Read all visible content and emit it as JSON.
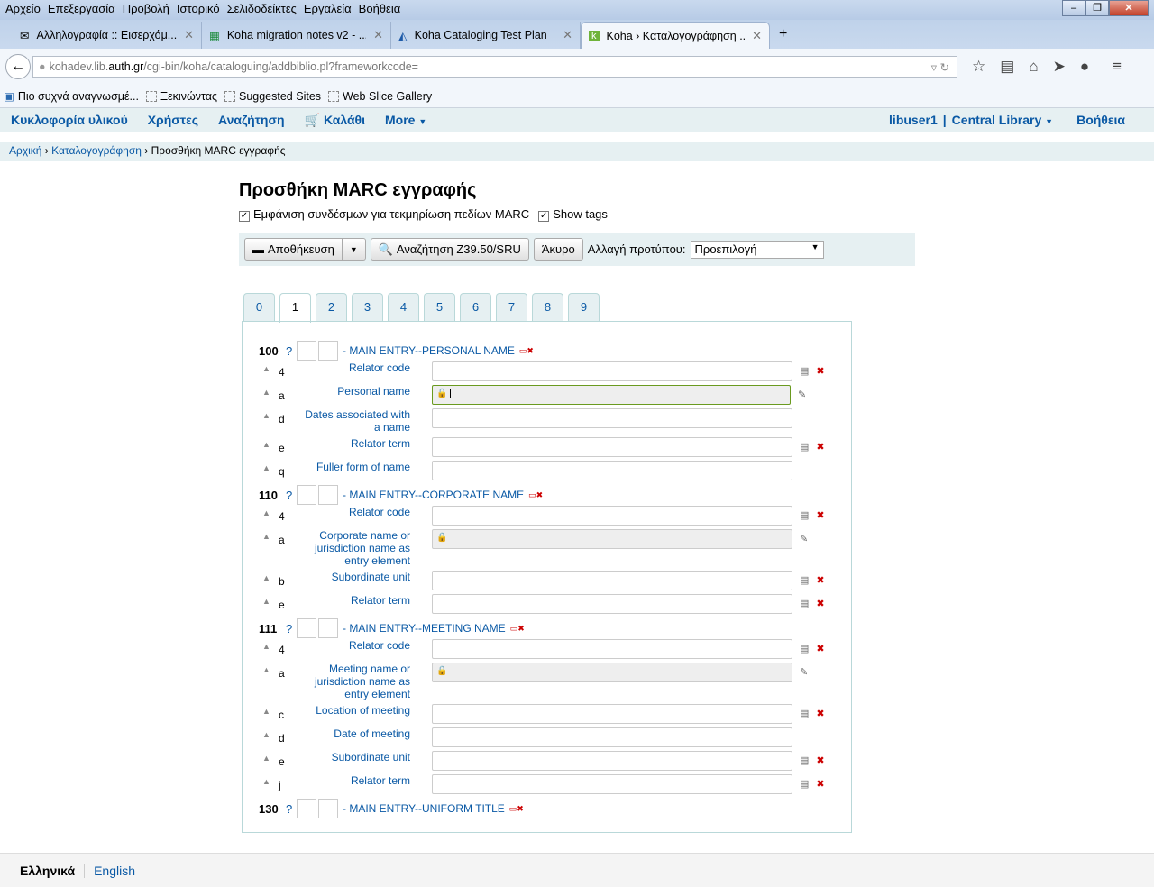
{
  "browser": {
    "menu": [
      "Αρχείο",
      "Επεξεργασία",
      "Προβολή",
      "Ιστορικό",
      "Σελιδοδείκτες",
      "Εργαλεία",
      "Βοήθεια"
    ],
    "tabs": [
      {
        "title": "Αλληλογραφία :: Εισερχόμ...",
        "icon": "mail-icon"
      },
      {
        "title": "Koha migration notes v2 - ...",
        "icon": "sheet-icon"
      },
      {
        "title": "Koha Cataloging Test Plan",
        "icon": "doc-icon"
      },
      {
        "title": "Koha › Καταλογογράφηση ...",
        "icon": "koha-icon",
        "active": true
      }
    ],
    "url_pre": "kohadev.lib.",
    "url_host": "auth.gr",
    "url_post": "/cgi-bin/koha/cataloguing/addbiblio.pl?frameworkcode=",
    "bookmarks": [
      "Πιο συχνά αναγνωσμέ...",
      "Ξεκινώντας",
      "Suggested Sites",
      "Web Slice Gallery"
    ]
  },
  "nav": {
    "items": [
      "Κυκλοφορία υλικού",
      "Χρήστες",
      "Αναζήτηση",
      "Καλάθι",
      "More"
    ],
    "user": "libuser1",
    "library": "Central Library",
    "help": "Βοήθεια"
  },
  "breadcrumbs": [
    "Αρχική",
    "Καταλογογράφηση",
    "Προσθήκη MARC εγγραφής"
  ],
  "page": {
    "title": "Προσθήκη MARC εγγραφής",
    "opt1": "Εμφάνιση συνδέσμων για τεκμηρίωση πεδίων MARC",
    "opt2": "Show tags",
    "save": "Αποθήκευση",
    "z3950": "Αναζήτηση Z39.50/SRU",
    "cancel": "Άκυρο",
    "template_label": "Αλλαγή προτύπου:",
    "template": "Προεπιλογή"
  },
  "tabs": [
    "0",
    "1",
    "2",
    "3",
    "4",
    "5",
    "6",
    "7",
    "8",
    "9"
  ],
  "active_tab": "1",
  "fields": [
    {
      "tag": "100",
      "name": "- MAIN ENTRY--PERSONAL NAME",
      "subfields": [
        {
          "code": "4",
          "label": "Relator code",
          "icons": "list-delete"
        },
        {
          "code": "a",
          "label": "Personal name",
          "icons": "plugin",
          "locked": true,
          "focused": true
        },
        {
          "code": "d",
          "label": "Dates associated with a name",
          "icons": "none"
        },
        {
          "code": "e",
          "label": "Relator term",
          "icons": "list-delete"
        },
        {
          "code": "q",
          "label": "Fuller form of name",
          "icons": "none"
        }
      ]
    },
    {
      "tag": "110",
      "name": "- MAIN ENTRY--CORPORATE NAME",
      "subfields": [
        {
          "code": "4",
          "label": "Relator code",
          "icons": "list-delete"
        },
        {
          "code": "a",
          "label": "Corporate name or jurisdiction name as entry element",
          "icons": "plugin",
          "locked": true
        },
        {
          "code": "b",
          "label": "Subordinate unit",
          "icons": "list-delete"
        },
        {
          "code": "e",
          "label": "Relator term",
          "icons": "list-delete"
        }
      ]
    },
    {
      "tag": "111",
      "name": "- MAIN ENTRY--MEETING NAME",
      "subfields": [
        {
          "code": "4",
          "label": "Relator code",
          "icons": "list-delete"
        },
        {
          "code": "a",
          "label": "Meeting name or jurisdiction name as entry element",
          "icons": "plugin",
          "locked": true
        },
        {
          "code": "c",
          "label": "Location of meeting",
          "icons": "list-delete"
        },
        {
          "code": "d",
          "label": "Date of meeting",
          "icons": "none"
        },
        {
          "code": "e",
          "label": "Subordinate unit",
          "icons": "list-delete"
        },
        {
          "code": "j",
          "label": "Relator term",
          "icons": "list-delete"
        }
      ]
    },
    {
      "tag": "130",
      "name": "- MAIN ENTRY--UNIFORM TITLE",
      "subfields": []
    }
  ],
  "footer": {
    "current": "Ελληνικά",
    "other": "English"
  }
}
